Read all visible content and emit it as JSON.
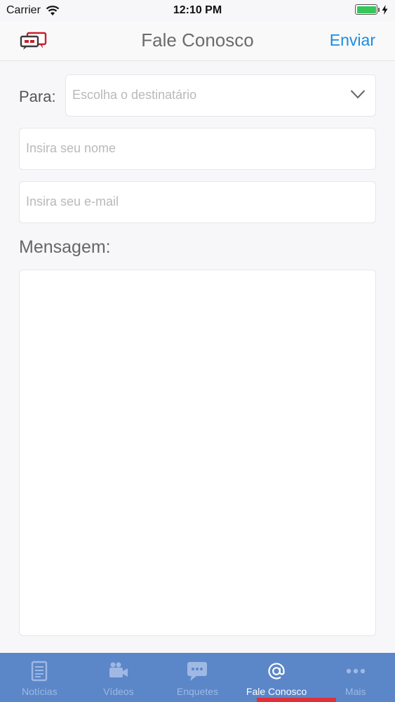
{
  "status_bar": {
    "carrier": "Carrier",
    "time": "12:10 PM",
    "battery_level": 1.0,
    "battery_color": "#34c759"
  },
  "nav": {
    "logo_icon": "chat-bubbles-logo-icon",
    "title": "Fale Conosco",
    "send_label": "Enviar",
    "accent": "#1a8ce0"
  },
  "form": {
    "to_label": "Para:",
    "recipient_placeholder": "Escolha o destinatário",
    "name_placeholder": "Insira seu nome",
    "email_placeholder": "Insira seu e-mail",
    "message_label": "Mensagem:"
  },
  "tab_bar": {
    "background": "#5b86c8",
    "indicator_color": "#e0303a",
    "items": [
      {
        "label": "Notícias",
        "icon": "document-icon",
        "active": false
      },
      {
        "label": "Vídeos",
        "icon": "video-camera-icon",
        "active": false
      },
      {
        "label": "Enquetes",
        "icon": "chat-bubble-icon",
        "active": false
      },
      {
        "label": "Fale Conosco",
        "icon": "at-sign-icon",
        "active": true
      },
      {
        "label": "Mais",
        "icon": "more-dots-icon",
        "active": false
      }
    ]
  }
}
